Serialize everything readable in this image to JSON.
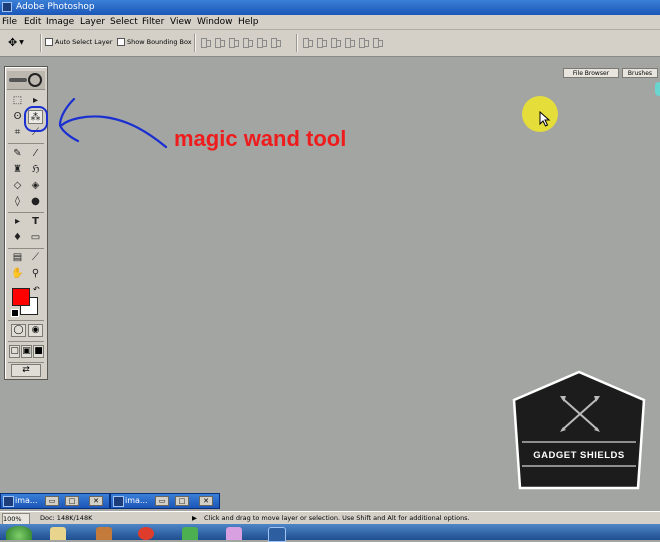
{
  "window": {
    "title": "Adobe Photoshop"
  },
  "menu": [
    "File",
    "Edit",
    "Image",
    "Layer",
    "Select",
    "Filter",
    "View",
    "Window",
    "Help"
  ],
  "options_bar": {
    "auto_select_layer": "Auto Select Layer",
    "show_bounding_box": "Show Bounding Box",
    "palette_tabs": [
      "File Browser",
      "Brushes"
    ]
  },
  "toolbox": {
    "selected_tool": "magic-wand",
    "foreground_color": "#ff0000",
    "background_color": "#ffffff"
  },
  "annotation": {
    "text": "magic wand tool",
    "text_color": "#ee1c1c",
    "stroke_color": "#1a2fd1"
  },
  "watermark": {
    "text": "GADGET SHIELDS"
  },
  "minimized_windows": [
    {
      "label": "ima..."
    },
    {
      "label": "ima..."
    }
  ],
  "status_bar": {
    "zoom": "100%",
    "doc": "Doc: 148K/148K",
    "hint": "Click and drag to move layer or selection.  Use Shift and Alt for additional options."
  },
  "colors": {
    "canvas_bg": "#a3a5a3",
    "ui_gray": "#d4d0c8",
    "title_blue": "#1b56b8",
    "cursor_highlight": "#f0e628"
  }
}
